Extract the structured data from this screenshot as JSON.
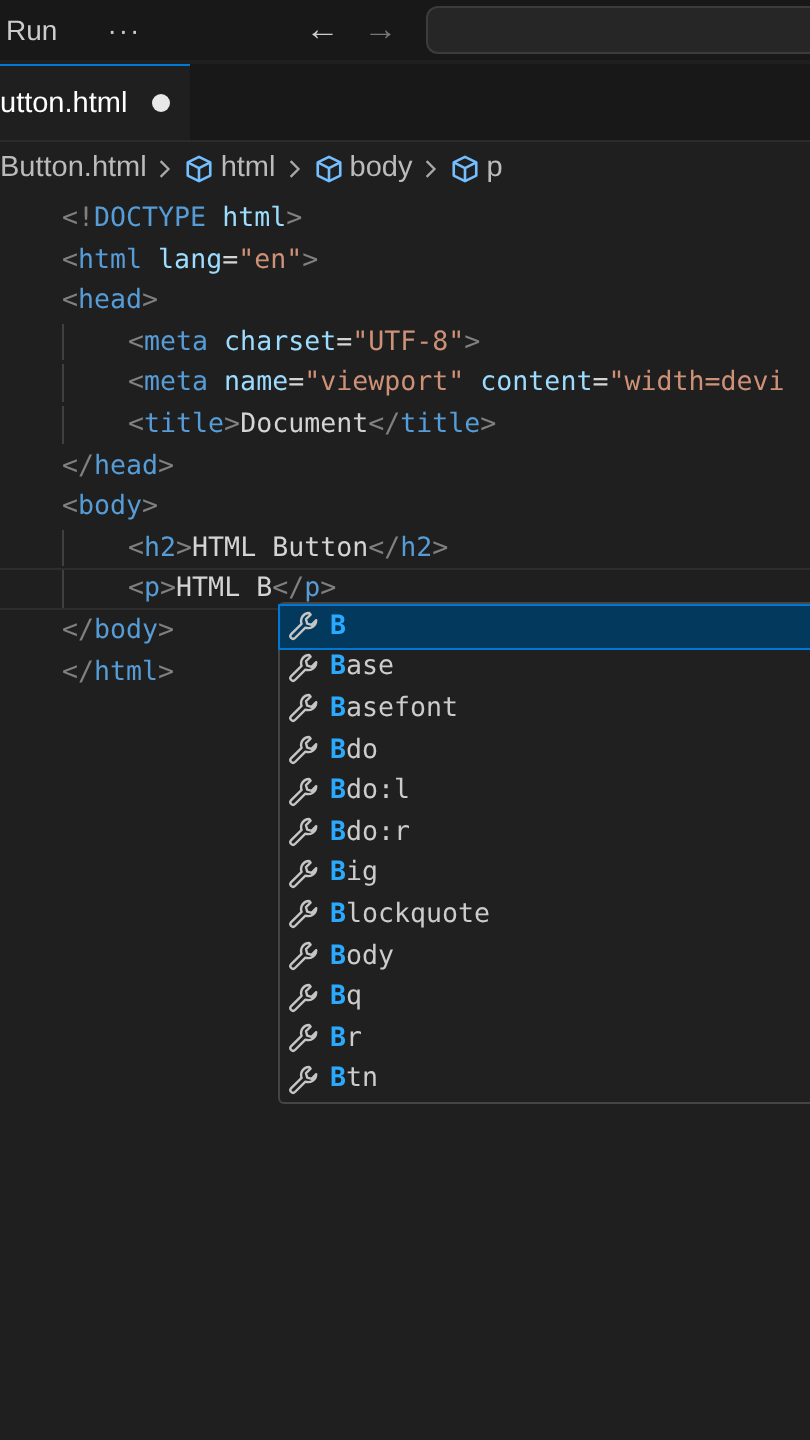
{
  "title_bar": {
    "menu": "Run",
    "more": "···",
    "back": "←",
    "forward": "→"
  },
  "tabs": [
    {
      "label": "utton.html",
      "modified": true,
      "selected": true
    }
  ],
  "breadcrumb": [
    {
      "label": "Button.html",
      "kind": "file"
    },
    {
      "label": "html",
      "kind": "element"
    },
    {
      "label": "body",
      "kind": "element"
    },
    {
      "label": "p",
      "kind": "element"
    }
  ],
  "code_lines": [
    {
      "indented": false,
      "current": false,
      "tokens": [
        {
          "kind": "punct",
          "text": "<!"
        },
        {
          "kind": "tag",
          "text": "DOCTYPE"
        },
        {
          "kind": "attr",
          "text": " html"
        },
        {
          "kind": "punct",
          "text": ">"
        }
      ]
    },
    {
      "indented": false,
      "current": false,
      "tokens": [
        {
          "kind": "punct",
          "text": "<"
        },
        {
          "kind": "tag",
          "text": "html"
        },
        {
          "kind": "attr",
          "text": " lang"
        },
        {
          "kind": "plain",
          "text": "="
        },
        {
          "kind": "string",
          "text": "\"en\""
        },
        {
          "kind": "punct",
          "text": ">"
        }
      ]
    },
    {
      "indented": false,
      "current": false,
      "tokens": [
        {
          "kind": "punct",
          "text": "<"
        },
        {
          "kind": "tag",
          "text": "head"
        },
        {
          "kind": "punct",
          "text": ">"
        }
      ]
    },
    {
      "indented": true,
      "current": false,
      "tokens": [
        {
          "kind": "punct",
          "text": "<"
        },
        {
          "kind": "tag",
          "text": "meta"
        },
        {
          "kind": "attr",
          "text": " charset"
        },
        {
          "kind": "plain",
          "text": "="
        },
        {
          "kind": "string",
          "text": "\"UTF-8\""
        },
        {
          "kind": "punct",
          "text": ">"
        }
      ]
    },
    {
      "indented": true,
      "current": false,
      "tokens": [
        {
          "kind": "punct",
          "text": "<"
        },
        {
          "kind": "tag",
          "text": "meta"
        },
        {
          "kind": "attr",
          "text": " name"
        },
        {
          "kind": "plain",
          "text": "="
        },
        {
          "kind": "string",
          "text": "\"viewport\""
        },
        {
          "kind": "attr",
          "text": " content"
        },
        {
          "kind": "plain",
          "text": "="
        },
        {
          "kind": "string",
          "text": "\"width=devi"
        }
      ]
    },
    {
      "indented": true,
      "current": false,
      "tokens": [
        {
          "kind": "punct",
          "text": "<"
        },
        {
          "kind": "tag",
          "text": "title"
        },
        {
          "kind": "punct",
          "text": ">"
        },
        {
          "kind": "plain",
          "text": "Document"
        },
        {
          "kind": "punct",
          "text": "</"
        },
        {
          "kind": "tag",
          "text": "title"
        },
        {
          "kind": "punct",
          "text": ">"
        }
      ]
    },
    {
      "indented": false,
      "current": false,
      "tokens": [
        {
          "kind": "punct",
          "text": "</"
        },
        {
          "kind": "tag",
          "text": "head"
        },
        {
          "kind": "punct",
          "text": ">"
        }
      ]
    },
    {
      "indented": false,
      "current": false,
      "tokens": [
        {
          "kind": "punct",
          "text": "<"
        },
        {
          "kind": "tag",
          "text": "body"
        },
        {
          "kind": "punct",
          "text": ">"
        }
      ]
    },
    {
      "indented": true,
      "current": false,
      "tokens": [
        {
          "kind": "punct",
          "text": "<"
        },
        {
          "kind": "tag",
          "text": "h2"
        },
        {
          "kind": "punct",
          "text": ">"
        },
        {
          "kind": "plain",
          "text": "HTML Button"
        },
        {
          "kind": "punct",
          "text": "</"
        },
        {
          "kind": "tag",
          "text": "h2"
        },
        {
          "kind": "punct",
          "text": ">"
        }
      ]
    },
    {
      "indented": true,
      "current": true,
      "tokens": [
        {
          "kind": "punct",
          "text": "<"
        },
        {
          "kind": "tag",
          "text": "p"
        },
        {
          "kind": "punct",
          "text": ">"
        },
        {
          "kind": "plain",
          "text": "HTML B"
        },
        {
          "kind": "punct",
          "text": "</"
        },
        {
          "kind": "tag",
          "text": "p"
        },
        {
          "kind": "punct",
          "text": ">"
        }
      ]
    },
    {
      "indented": false,
      "current": false,
      "tokens": [
        {
          "kind": "punct",
          "text": "</"
        },
        {
          "kind": "tag",
          "text": "body"
        },
        {
          "kind": "punct",
          "text": ">"
        }
      ]
    },
    {
      "indented": false,
      "current": false,
      "tokens": [
        {
          "kind": "punct",
          "text": "</"
        },
        {
          "kind": "tag",
          "text": "html"
        },
        {
          "kind": "punct",
          "text": ">"
        }
      ]
    }
  ],
  "suggestions": [
    {
      "match": "B",
      "selected": true
    },
    {
      "match": "B",
      "rest": "ase",
      "selected": false
    },
    {
      "match": "B",
      "rest": "asefont",
      "selected": false
    },
    {
      "match": "B",
      "rest": "do",
      "selected": false
    },
    {
      "match": "B",
      "rest": "do:l",
      "selected": false
    },
    {
      "match": "B",
      "rest": "do:r",
      "selected": false
    },
    {
      "match": "B",
      "rest": "ig",
      "selected": false
    },
    {
      "match": "B",
      "rest": "lockquote",
      "selected": false
    },
    {
      "match": "B",
      "rest": "ody",
      "selected": false
    },
    {
      "match": "B",
      "rest": "q",
      "selected": false
    },
    {
      "match": "B",
      "rest": "r",
      "selected": false
    },
    {
      "match": "B",
      "rest": "tn",
      "selected": false
    }
  ]
}
